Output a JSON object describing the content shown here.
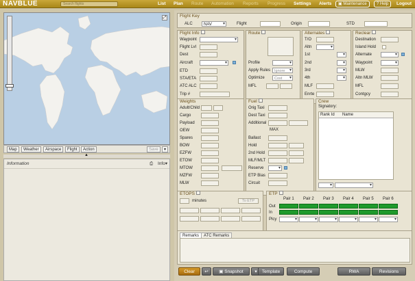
{
  "topbar": {
    "logo": "NAVBLUE",
    "search_placeholder": "Search flights",
    "nav": [
      "List",
      "Plan",
      "Route",
      "Automation",
      "Reports",
      "Progress",
      "Settings",
      "Alerts"
    ],
    "maintenance": "Maintenance",
    "help": "Help",
    "logout": "Logout",
    "colors": {
      "bar": "#b8961f",
      "nav_active": "#ffffff",
      "nav_dim": "#e6d596"
    }
  },
  "map": {
    "buttons": [
      "Map",
      "Weather",
      "Airspace",
      "Flight",
      "Action"
    ],
    "save": "Save"
  },
  "info": {
    "title": "Information",
    "menu": "Info"
  },
  "flightkey": {
    "title": "Flight Key",
    "alc": "ALC",
    "alc_value": "NAV",
    "flight": "Flight",
    "origin": "Origin",
    "std": "STD"
  },
  "flightinfo": {
    "title": "Flight Info",
    "labels": [
      "Waypoint",
      "Flight Lvl",
      "Dest",
      "Aircraft",
      "ETD",
      "STA/ETA",
      "ATC ALC",
      "Trip #"
    ]
  },
  "route": {
    "title": "Route",
    "profile": "Profile",
    "apply_rules": "Apply Rules",
    "apply_value": "Ignore",
    "optimize": "Optimize",
    "optimize_value": "Cost",
    "mfl": "MFL"
  },
  "alternates": {
    "title": "Alternates",
    "labels": [
      "T/O",
      "Altn",
      "1st",
      "2nd",
      "3rd",
      "4th",
      "MLF",
      "Enrte"
    ]
  },
  "reclear": {
    "title": "Reclear",
    "labels": [
      "Destination",
      "Island Hold",
      "Alternate",
      "Waypoint",
      "MLW",
      "Altn MLW",
      "MFL",
      "Contgcy"
    ]
  },
  "weights": {
    "title": "Weights",
    "labels": [
      "Adult/Child",
      "Cargo",
      "Payload",
      "OEW",
      "Spares",
      "BOW",
      "EZFW",
      "ETOW",
      "MTOW",
      "MZFW",
      "MLW"
    ]
  },
  "fuel": {
    "title": "Fuel",
    "labels": [
      "Orig Taxi",
      "Dest Taxi",
      "Additional",
      "",
      "Ballast",
      "Hold",
      "2nd Hold",
      "MLF/MLT",
      "Reserve",
      "ETP Bias",
      "Circuit"
    ],
    "max": "MAX"
  },
  "crew": {
    "title": "Crew",
    "signatory": "Signatory:",
    "cols": [
      "Rank Id",
      "Name"
    ]
  },
  "etops": {
    "title": "ETOPS",
    "minutes": "minutes",
    "etp_btn": "To ETP"
  },
  "etp": {
    "title": "ETP",
    "pairs": [
      "Pair 1",
      "Pair 2",
      "Pair 3",
      "Pair 4",
      "Pair 5",
      "Pair 6"
    ],
    "out": "Out",
    "in": "In",
    "plcy": "Plcy"
  },
  "remarks": {
    "tabs": [
      "Remarks",
      "ATC Remarks"
    ]
  },
  "bottom": {
    "clear": "Clear",
    "snapshot": "Snapshot",
    "template": "Template",
    "compute": "Compute",
    "rwa": "RWA",
    "revisions": "Revisions"
  }
}
